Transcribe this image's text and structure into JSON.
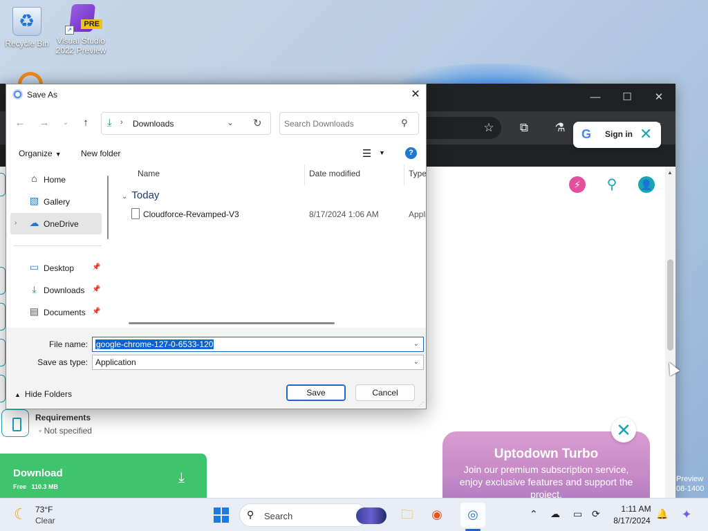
{
  "desktop": {
    "icons": [
      {
        "label": "Recycle Bin"
      },
      {
        "label": "Visual Studio 2022 Preview",
        "badge": "PRE"
      }
    ]
  },
  "browser": {
    "window_controls": {
      "minimize": "—",
      "maximize": "☐",
      "close": "✕"
    },
    "page": {
      "signin_label": "Sign in",
      "requirements_title": "Requirements",
      "requirements_value": "Not specified",
      "download_label": "Download",
      "download_sub": "Free",
      "download_size": "110.3 MB",
      "turbo_title": "Uptodown Turbo",
      "turbo_text": "Join our premium subscription service, enjoy exclusive features and support the project.",
      "watermark_line1": "Preview",
      "watermark_line2": "08-1400"
    }
  },
  "dialog": {
    "title": "Save As",
    "address": {
      "location": "Downloads"
    },
    "search_placeholder": "Search Downloads",
    "commands": {
      "organize": "Organize",
      "new_folder": "New folder"
    },
    "nav": [
      {
        "label": "Home",
        "icon": "home-icon"
      },
      {
        "label": "Gallery",
        "icon": "gallery-icon"
      },
      {
        "label": "OneDrive",
        "icon": "onedrive-icon",
        "selected": true
      },
      {
        "label": "Desktop",
        "icon": "desktop-icon",
        "pinned": true
      },
      {
        "label": "Downloads",
        "icon": "downloads-icon",
        "pinned": true
      },
      {
        "label": "Documents",
        "icon": "documents-icon",
        "pinned": true
      }
    ],
    "columns": {
      "name": "Name",
      "date": "Date modified",
      "type": "Type"
    },
    "group": "Today",
    "files": [
      {
        "name": "Cloudforce-Revamped-V3",
        "date": "8/17/2024 1:06 AM",
        "type": "Appli"
      }
    ],
    "form": {
      "file_name_label": "File name:",
      "file_name_value": "google-chrome-127-0-6533-120",
      "save_type_label": "Save as type:",
      "save_type_value": "Application"
    },
    "hide_folders": "Hide Folders",
    "save_button": "Save",
    "cancel_button": "Cancel"
  },
  "taskbar": {
    "weather_temp": "73°F",
    "weather_desc": "Clear",
    "search_label": "Search",
    "time": "1:11 AM",
    "date": "8/17/2024"
  },
  "colors": {
    "accent": "#1f66c4",
    "uptodown_teal": "#19a4b4",
    "download_green": "#3ec46d",
    "chrome_dark": "#202124"
  }
}
